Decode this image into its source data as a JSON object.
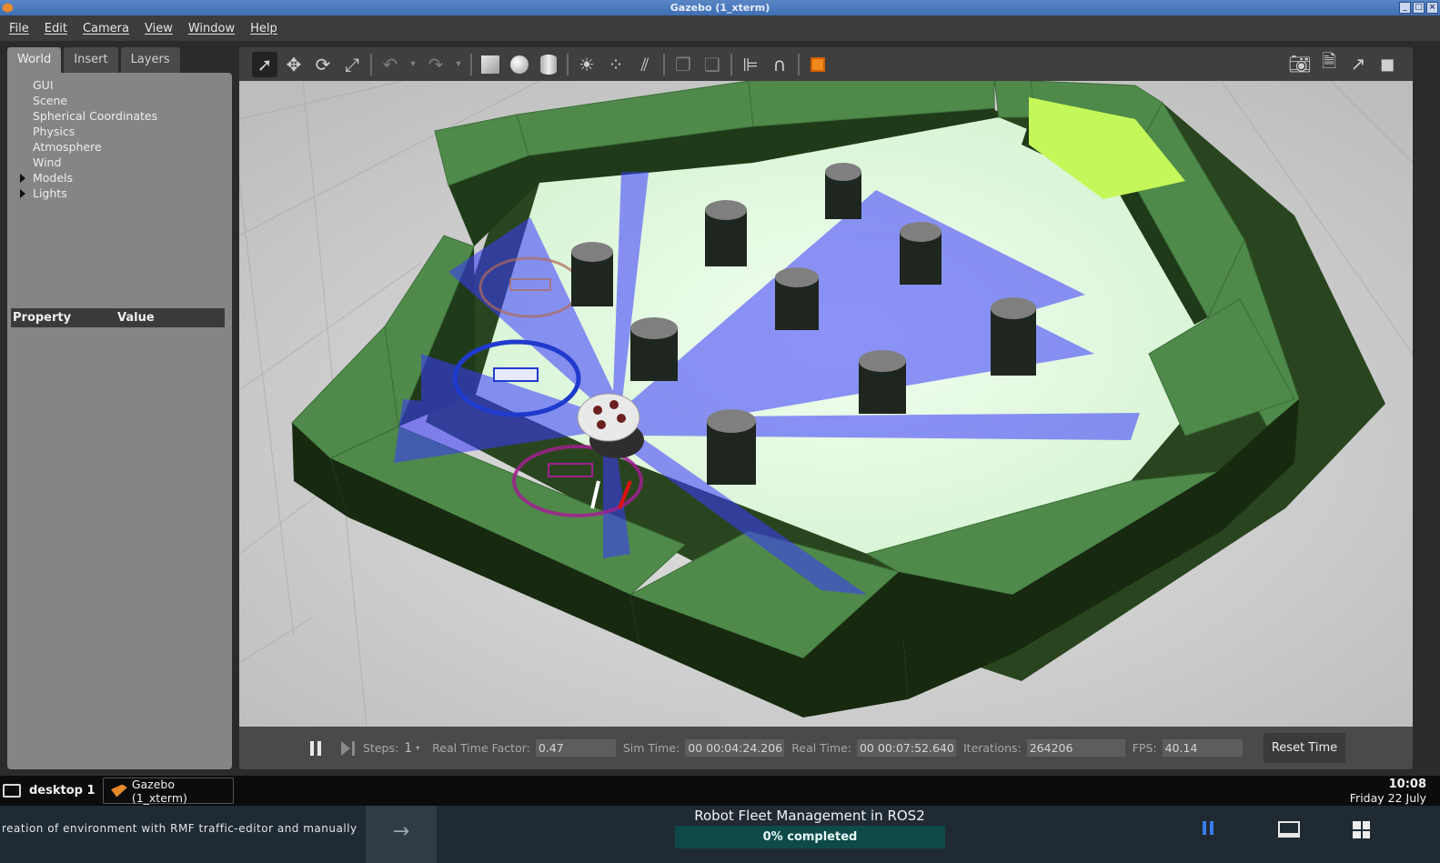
{
  "window": {
    "title": "Gazebo (1_xterm)",
    "controls": [
      "_",
      "□",
      "×"
    ]
  },
  "menubar": [
    "File",
    "Edit",
    "Camera",
    "View",
    "Window",
    "Help"
  ],
  "left_panel": {
    "tabs": [
      "World",
      "Insert",
      "Layers"
    ],
    "active_tab": "World",
    "tree": [
      {
        "label": "GUI",
        "expandable": false
      },
      {
        "label": "Scene",
        "expandable": false
      },
      {
        "label": "Spherical Coordinates",
        "expandable": false
      },
      {
        "label": "Physics",
        "expandable": false
      },
      {
        "label": "Atmosphere",
        "expandable": false
      },
      {
        "label": "Wind",
        "expandable": false
      },
      {
        "label": "Models",
        "expandable": true
      },
      {
        "label": "Lights",
        "expandable": true
      }
    ],
    "property_header": {
      "property": "Property",
      "value": "Value"
    }
  },
  "toolbar": {
    "tools": [
      "select-arrow-icon",
      "translate-icon",
      "rotate-icon",
      "scale-icon",
      "undo-icon",
      "redo-icon",
      "box-shape-icon",
      "sphere-shape-icon",
      "cylinder-shape-icon",
      "point-light-icon",
      "spot-light-icon",
      "directional-light-icon",
      "copy-icon",
      "paste-icon",
      "align-icon",
      "magnet-snap-icon",
      "view-angle-icon"
    ],
    "right_tools": [
      "screenshot-icon",
      "log-icon",
      "plot-icon",
      "record-video-icon"
    ]
  },
  "simbar": {
    "steps_label": "Steps:",
    "steps_value": "1",
    "real_time_factor_label": "Real Time Factor:",
    "real_time_factor": "0.47",
    "sim_time_label": "Sim Time:",
    "sim_time": "00 00:04:24.206",
    "real_time_label": "Real Time:",
    "real_time": "00 00:07:52.640",
    "iterations_label": "Iterations:",
    "iterations": "264206",
    "fps_label": "FPS:",
    "fps": "40.14",
    "reset_label": "Reset Time"
  },
  "taskbar": {
    "desktop": "desktop 1",
    "task": "Gazebo (1_xterm)",
    "time": "10:08",
    "date": "Friday 22 July"
  },
  "course": {
    "previous_lesson": "reation of environment with RMF traffic-editor and manually",
    "title": "Robot Fleet Management in ROS2",
    "progress": 0,
    "progress_text": "0% completed"
  },
  "colors": {
    "wall": "#4f8a4a",
    "floor": "#dff7dd",
    "laser": "#3a3aff",
    "ground": "#c9c9c9",
    "highlight_wall": "#c4f75a"
  }
}
